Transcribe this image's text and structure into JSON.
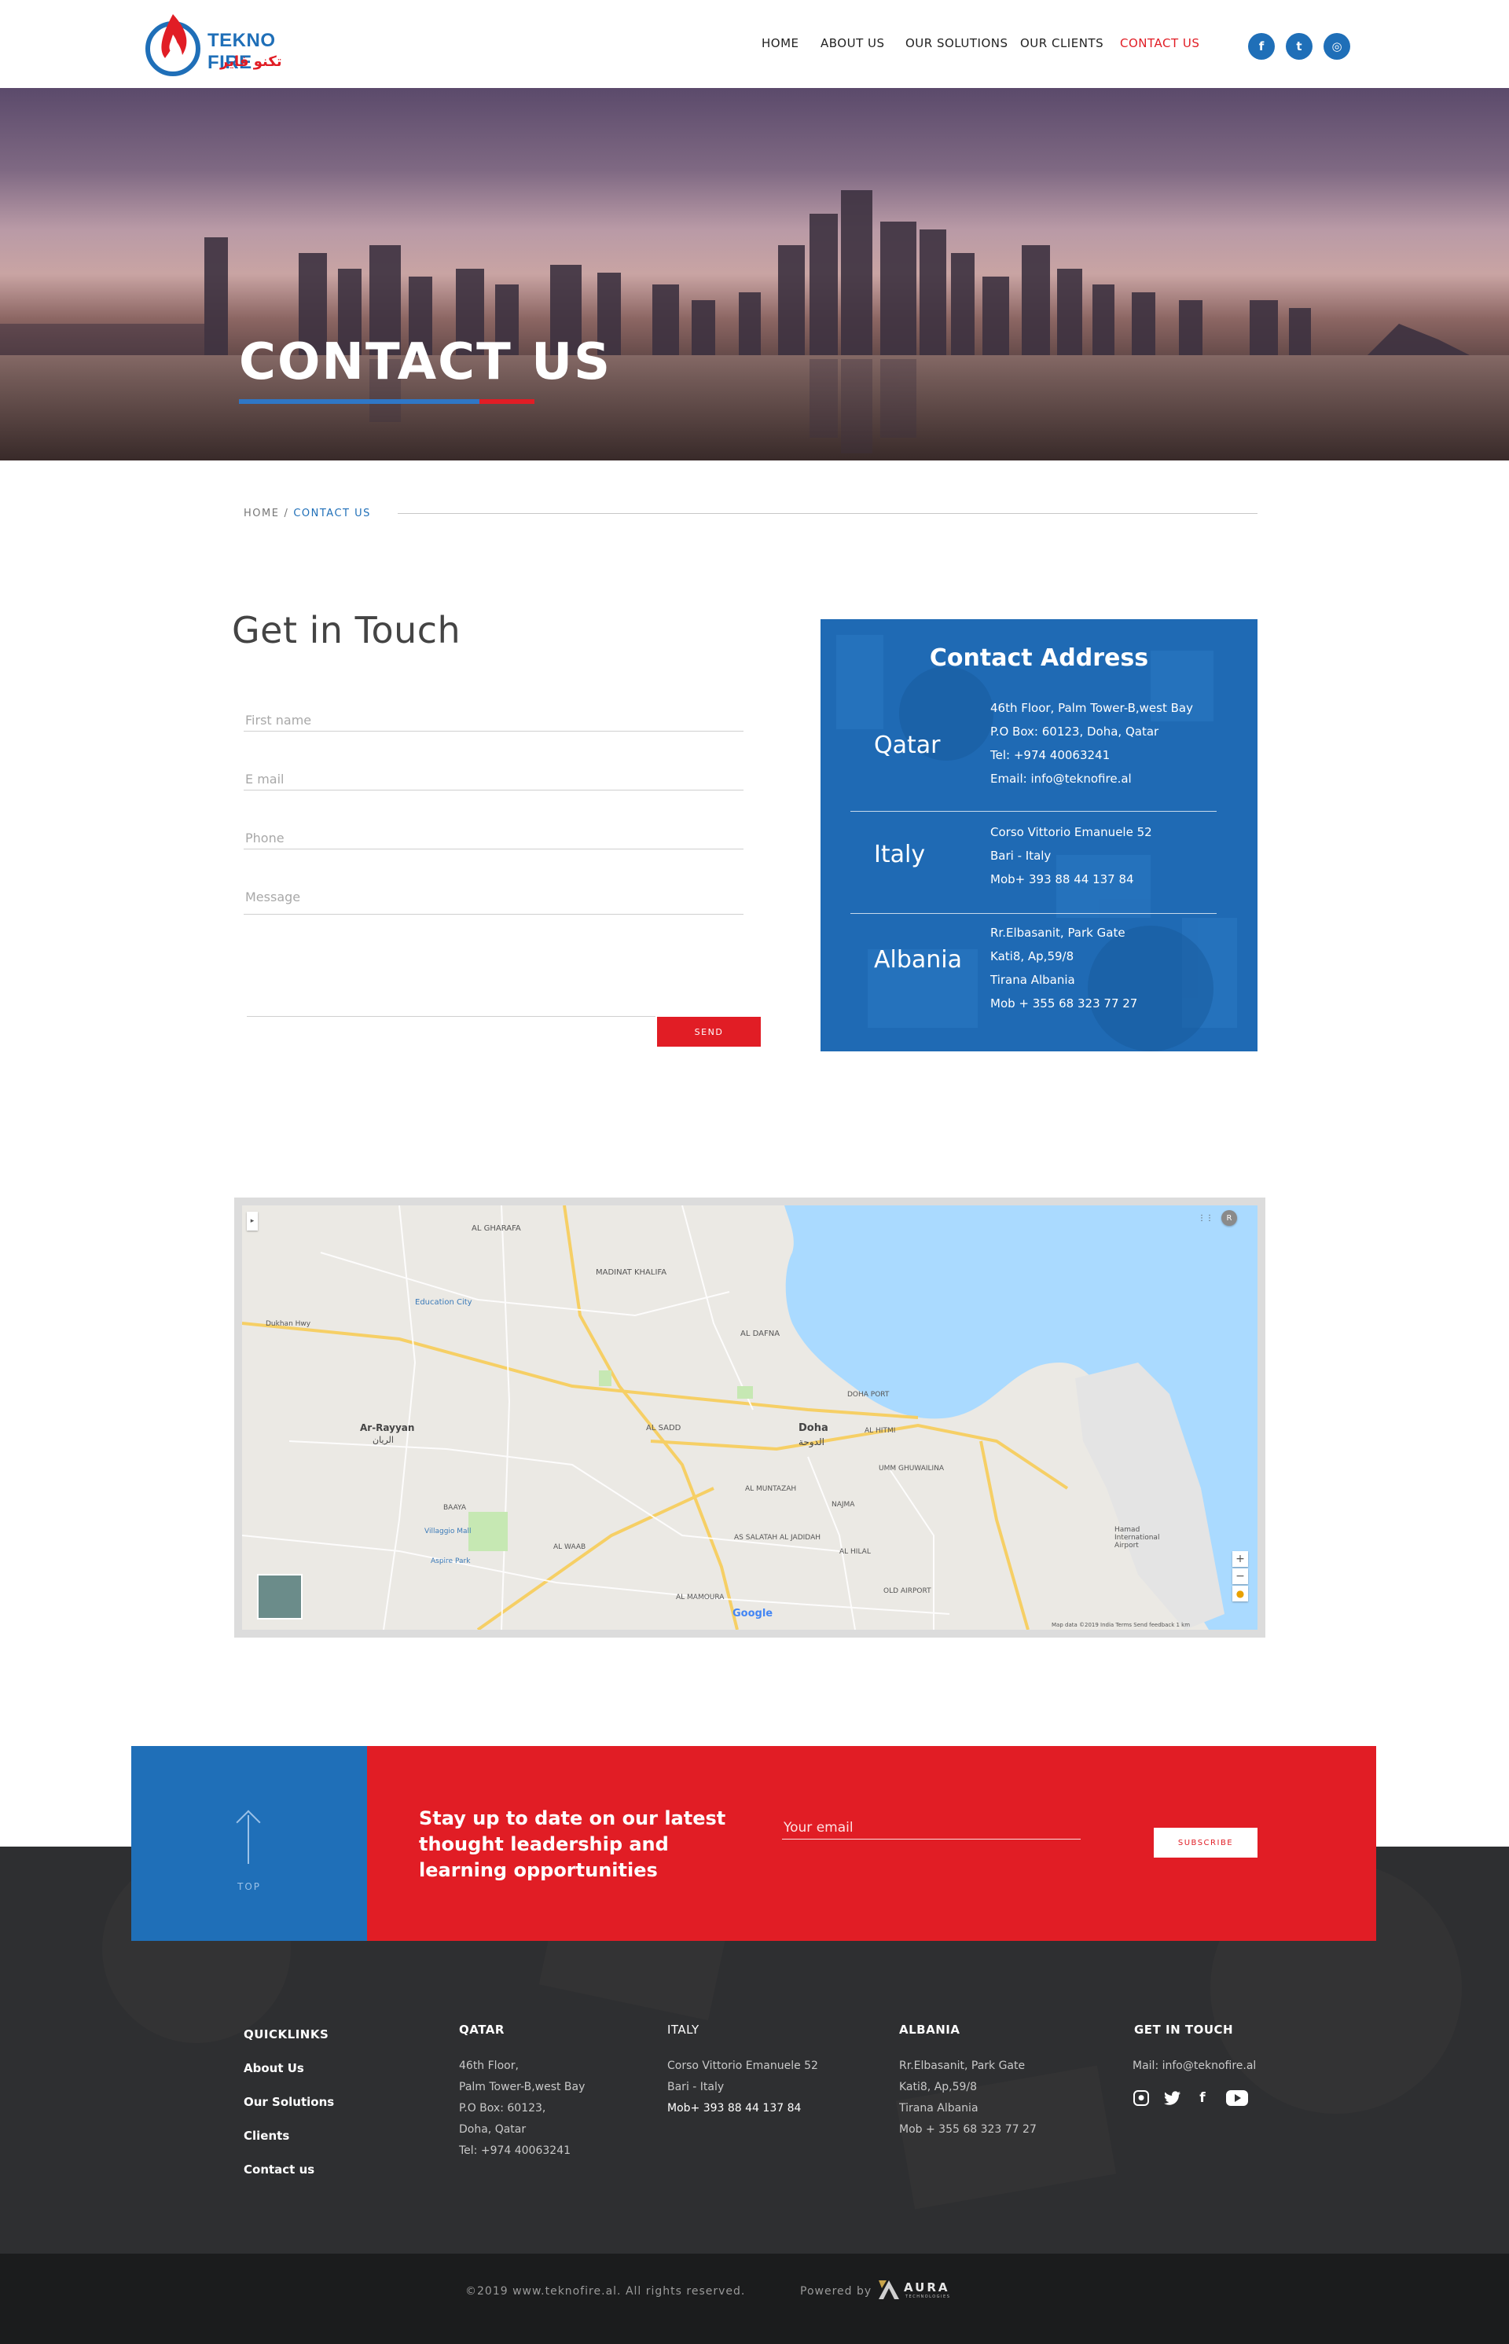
{
  "brand": {
    "name_en": "TEKNO FIRE",
    "name_ar": "تكنو فاير",
    "primary": "#1f6fb8",
    "accent": "#e11d25",
    "footer_bg": "#2e2f31"
  },
  "nav": {
    "items": [
      {
        "label": "HOME"
      },
      {
        "label": "ABOUT US"
      },
      {
        "label": "OUR SOLUTIONS"
      },
      {
        "label": "OUR CLIENTS"
      },
      {
        "label": "CONTACT US",
        "active": true
      }
    ],
    "social": [
      {
        "icon": "facebook-icon",
        "glyph": "f"
      },
      {
        "icon": "twitter-icon",
        "glyph": "t"
      },
      {
        "icon": "instagram-icon",
        "glyph": "◎"
      }
    ]
  },
  "hero": {
    "title": "CONTACT US"
  },
  "breadcrumb": {
    "home": "HOME",
    "separator": "/",
    "current": "CONTACT US"
  },
  "form": {
    "title": "Get in Touch",
    "first_name_placeholder": "First name",
    "email_placeholder": "E mail",
    "phone_placeholder": "Phone",
    "message_placeholder": "Message",
    "send_label": "SEND"
  },
  "contact_address": {
    "title": "Contact Address",
    "offices": [
      {
        "country": "Qatar",
        "lines": [
          "46th Floor, Palm Tower-B,west Bay",
          "P.O Box: 60123, Doha, Qatar",
          "Tel: +974 40063241",
          "Email: info@teknofire.al"
        ]
      },
      {
        "country": "Italy",
        "lines": [
          "Corso Vittorio Emanuele 52",
          "Bari - Italy",
          "Mob+ 393 88 44 137 84"
        ]
      },
      {
        "country": "Albania",
        "lines": [
          "Rr.Elbasanit, Park Gate",
          "Kati8, Ap,59/8",
          "Tirana Albania",
          "Mob + 355 68 323 77 27"
        ]
      }
    ]
  },
  "map": {
    "labels": {
      "doha": "Doha",
      "doha_ar": "الدوحة",
      "ar_rayyan": "Ar-Rayyan",
      "ar_rayyan_ar": "الريان",
      "al_gharafa": "AL GHARAFA",
      "madinat_khalifa": "MADINAT KHALIFA",
      "education_city": "Education City",
      "al_dafna": "AL DAFNA",
      "doha_port": "DOHA PORT",
      "al_sadd": "AL SADD",
      "al_hitmi": "AL HITMI",
      "umm_ghuwailina": "UMM GHUWAILINA",
      "al_muntazah": "AL MUNTAZAH",
      "najma": "NAJMA",
      "baaya": "BAAYA",
      "villaggio_mall": "Villaggio Mall",
      "aspire_park": "Aspire Park",
      "al_waab": "AL WAAB",
      "as_salatah": "AS SALATAH AL JADIDAH",
      "al_hilal": "AL HILAL",
      "old_airport": "OLD AIRPORT",
      "al_mamoura": "AL MAMOURA",
      "hamad_airport": "Hamad International Airport",
      "dukhan_hwy": "Dukhan Hwy",
      "google": "Google",
      "footer_strip": "Map data ©2019   India   Terms   Send feedback   1 km"
    }
  },
  "subscribe": {
    "top_label": "TOP",
    "headline": "Stay up to date on our latest thought leadership and learning opportunities",
    "email_placeholder": "Your email",
    "button_label": "SUBSCRIBE"
  },
  "footer": {
    "quicklinks": {
      "heading": "QUICKLINKS",
      "links": [
        "About Us",
        "Our Solutions",
        "Clients",
        "Contact us"
      ]
    },
    "qatar": {
      "heading": "QATAR",
      "lines": [
        "46th Floor,",
        "Palm Tower-B,west Bay",
        "P.O Box: 60123,",
        "Doha, Qatar",
        "Tel: +974 40063241"
      ]
    },
    "italy": {
      "heading": "ITALY",
      "lines": [
        "Corso Vittorio Emanuele 52",
        "Bari - Italy",
        "Mob+ 393 88 44 137 84"
      ]
    },
    "albania": {
      "heading": "ALBANIA",
      "lines": [
        "Rr.Elbasanit, Park Gate",
        "Kati8, Ap,59/8",
        "Tirana Albania",
        "Mob + 355 68 323 77 27"
      ]
    },
    "get_in_touch": {
      "heading": "GET IN TOUCH",
      "mail": "Mail: info@teknofire.al",
      "icons": [
        "instagram-icon",
        "twitter-icon",
        "facebook-icon",
        "youtube-icon"
      ]
    }
  },
  "bottom_bar": {
    "copyright": "©2019 www.teknofire.al. All rights reserved.",
    "powered_by": "Powered by",
    "aura_word": "AURA",
    "aura_sub": "TECHNOLOGIES"
  }
}
